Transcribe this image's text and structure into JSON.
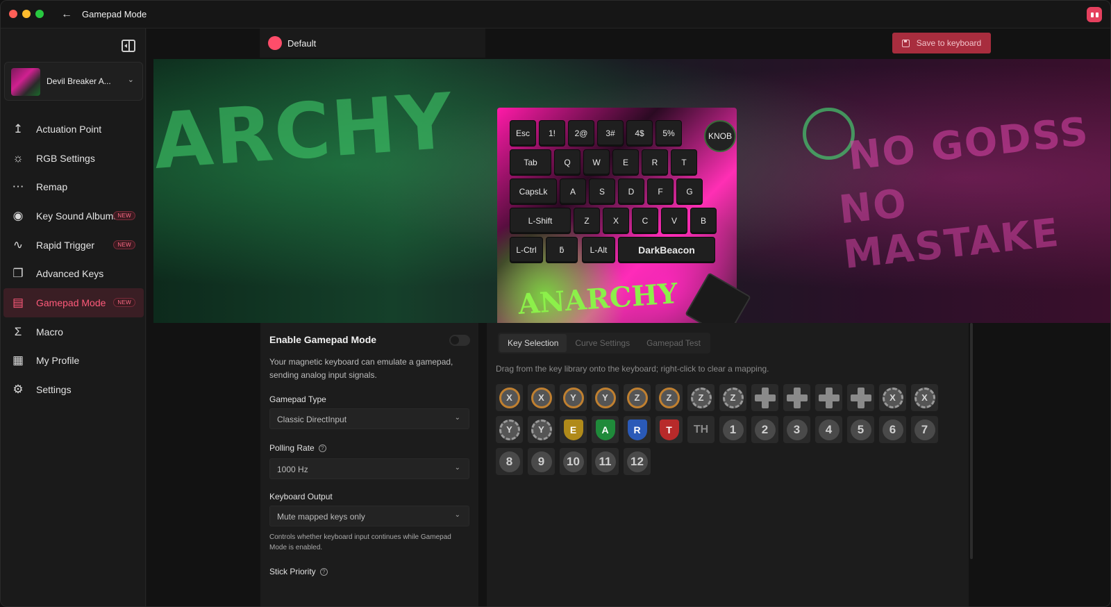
{
  "window": {
    "title": "Gamepad Mode"
  },
  "sidebar": {
    "device": {
      "name": "Devil Breaker A..."
    },
    "items": [
      {
        "label": "Actuation Point",
        "icon": "actuation-icon",
        "new": false,
        "active": false
      },
      {
        "label": "RGB Settings",
        "icon": "sun-icon",
        "new": false,
        "active": false
      },
      {
        "label": "Remap",
        "icon": "keyboard-icon",
        "new": false,
        "active": false
      },
      {
        "label": "Key Sound Albums",
        "icon": "disc-icon",
        "new": true,
        "active": false
      },
      {
        "label": "Rapid Trigger",
        "icon": "pulse-icon",
        "new": true,
        "active": false
      },
      {
        "label": "Advanced Keys",
        "icon": "layers-icon",
        "new": false,
        "active": false
      },
      {
        "label": "Gamepad Mode",
        "icon": "gamepad-icon",
        "new": true,
        "active": true
      },
      {
        "label": "Macro",
        "icon": "sigma-icon",
        "new": false,
        "active": false
      },
      {
        "label": "My Profile",
        "icon": "grid-icon",
        "new": false,
        "active": false
      },
      {
        "label": "Settings",
        "icon": "gear-icon",
        "new": false,
        "active": false
      }
    ],
    "new_badge": "NEW"
  },
  "profile": {
    "name": "Default",
    "color": "#ff4d6a"
  },
  "toolbar": {
    "save_label": "Save to keyboard"
  },
  "banner": {
    "graffiti_left": "ARCHY",
    "graffiti_right_1": "NO GODSS",
    "graffiti_right_2": "NO MASTAKE",
    "keyboard_logo": "ANARCHY"
  },
  "keyboard": {
    "knob": "KNOB",
    "rows": [
      [
        "Esc",
        "1!",
        "2@",
        "3#",
        "4$",
        "5%"
      ],
      [
        "Tab",
        "Q",
        "W",
        "E",
        "R",
        "T"
      ],
      [
        "CapsLk",
        "A",
        "S",
        "D",
        "F",
        "G"
      ],
      [
        "L-Shift",
        "Z",
        "X",
        "C",
        "V",
        "B"
      ],
      [
        "L-Ctrl",
        "ƃ",
        "L-Alt",
        "DarkBeacon"
      ]
    ]
  },
  "settings": {
    "enable_title": "Enable Gamepad Mode",
    "enabled": false,
    "description": "Your magnetic keyboard can emulate a gamepad, sending analog input signals.",
    "gamepad_type": {
      "label": "Gamepad Type",
      "value": "Classic DirectInput"
    },
    "polling_rate": {
      "label": "Polling Rate",
      "value": "1000 Hz"
    },
    "keyboard_output": {
      "label": "Keyboard Output",
      "value": "Mute mapped keys only",
      "note": "Controls whether keyboard input continues while Gamepad Mode is enabled."
    },
    "stick_priority": {
      "label": "Stick Priority"
    }
  },
  "library": {
    "tabs": [
      "Key Selection",
      "Curve Settings",
      "Gamepad Test"
    ],
    "active_tab": 0,
    "hint": "Drag from the key library onto the keyboard; right-click to clear a mapping.",
    "keys": [
      {
        "kind": "circle",
        "label": "X",
        "style": "ring"
      },
      {
        "kind": "circle",
        "label": "X",
        "style": "ring"
      },
      {
        "kind": "circle",
        "label": "Y",
        "style": "ring"
      },
      {
        "kind": "circle",
        "label": "Y",
        "style": "ring"
      },
      {
        "kind": "circle",
        "label": "Z",
        "style": "ring"
      },
      {
        "kind": "circle",
        "label": "Z",
        "style": "ring"
      },
      {
        "kind": "circle",
        "label": "Z",
        "style": "rot"
      },
      {
        "kind": "circle",
        "label": "Z",
        "style": "rot"
      },
      {
        "kind": "dpad",
        "label": ""
      },
      {
        "kind": "dpad",
        "label": ""
      },
      {
        "kind": "dpad",
        "label": ""
      },
      {
        "kind": "dpad",
        "label": ""
      },
      {
        "kind": "circle",
        "label": "X",
        "style": "rot"
      },
      {
        "kind": "circle",
        "label": "X",
        "style": "rot"
      },
      {
        "kind": "circle",
        "label": "Y",
        "style": "rot"
      },
      {
        "kind": "circle",
        "label": "Y",
        "style": "rot"
      },
      {
        "kind": "shield",
        "label": "E",
        "color": "#b08a1a"
      },
      {
        "kind": "shield",
        "label": "A",
        "color": "#1f8a3a"
      },
      {
        "kind": "shield",
        "label": "R",
        "color": "#2a5ab8"
      },
      {
        "kind": "shield",
        "label": "T",
        "color": "#b82a2a"
      },
      {
        "kind": "text",
        "label": "TH"
      },
      {
        "kind": "num",
        "label": "1"
      },
      {
        "kind": "num",
        "label": "2"
      },
      {
        "kind": "num",
        "label": "3"
      },
      {
        "kind": "num",
        "label": "4"
      },
      {
        "kind": "num",
        "label": "5"
      },
      {
        "kind": "num",
        "label": "6"
      },
      {
        "kind": "num",
        "label": "7"
      },
      {
        "kind": "num",
        "label": "8"
      },
      {
        "kind": "num",
        "label": "9"
      },
      {
        "kind": "num",
        "label": "10"
      },
      {
        "kind": "num",
        "label": "11"
      },
      {
        "kind": "num",
        "label": "12"
      }
    ]
  }
}
